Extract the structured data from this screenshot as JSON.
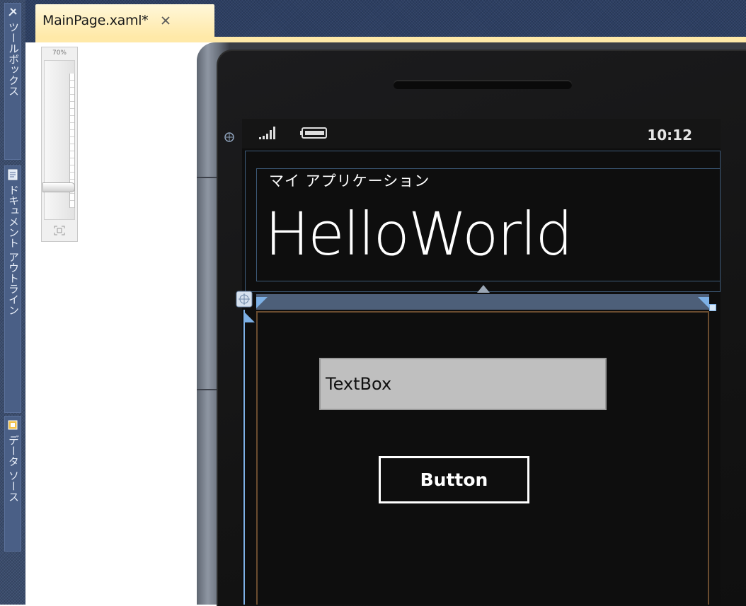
{
  "window": {
    "title": ""
  },
  "doc_tab": {
    "title": "MainPage.xaml*",
    "close_icon": "close-icon"
  },
  "side_strip": {
    "tabs": [
      {
        "label": "ツールボックス",
        "icon": "toolbox-icon"
      },
      {
        "label": "ドキュメント アウトライン",
        "icon": "document-outline-icon"
      },
      {
        "label": "データ ソース",
        "icon": "data-source-icon"
      }
    ]
  },
  "zoom": {
    "label": "70%",
    "level_percent": 70,
    "fit_icon": "zoom-fit-icon"
  },
  "phone": {
    "status_time": "10:12",
    "signal_icon": "signal-strength-icon",
    "battery_icon": "battery-icon",
    "app_name": "マイ アプリケーション",
    "page_title": "HelloWorld",
    "textbox_text": "TextBox",
    "button_label": "Button"
  },
  "colors": {
    "ide_chrome": "#2d3f63",
    "tab_active": "#ffe9a8",
    "selection": "#7db0e5",
    "phone_screen": "#0e0e0e",
    "textbox_bg": "#bfbfbf"
  }
}
